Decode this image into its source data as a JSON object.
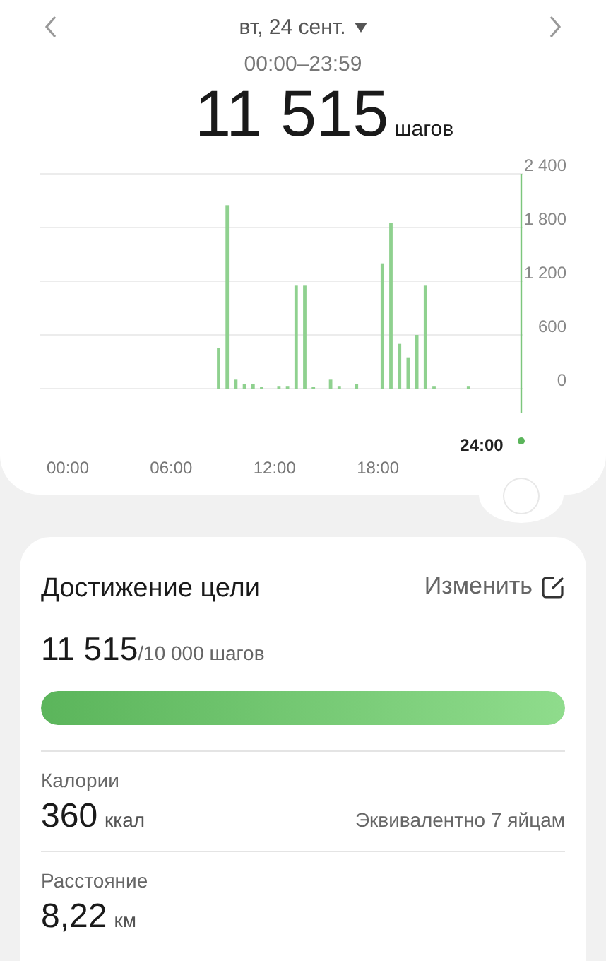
{
  "header": {
    "date": "вт, 24 сент.",
    "time_range": "00:00–23:59",
    "steps": "11 515",
    "steps_unit": "шагов"
  },
  "chart": {
    "cursor_label": "24:00",
    "chart_data": {
      "type": "bar",
      "x": [
        8.75,
        9.25,
        9.75,
        10.25,
        10.75,
        11.25,
        12.25,
        12.75,
        13.25,
        13.75,
        14.25,
        15.25,
        15.75,
        16.75,
        18.25,
        18.75,
        19.25,
        19.75,
        20.25,
        20.75,
        21.25,
        23.25
      ],
      "series": [
        {
          "color": "#8fd18f",
          "values": [
            450,
            2050,
            100,
            50,
            50,
            20,
            30,
            30,
            1150,
            1150,
            20,
            100,
            30,
            50,
            1400,
            1850,
            500,
            350,
            600,
            1150,
            30,
            30
          ]
        }
      ],
      "xticks": [
        {
          "value": 0,
          "label": "00:00"
        },
        {
          "value": 6,
          "label": "06:00"
        },
        {
          "value": 12,
          "label": "12:00"
        },
        {
          "value": 18,
          "label": "18:00"
        }
      ],
      "xlim": [
        -1.6,
        26.4
      ],
      "grid": true,
      "yticks": [
        {
          "value": 2400,
          "label": "2 400"
        },
        {
          "value": 1800,
          "label": "1 800"
        },
        {
          "value": 1200,
          "label": "1 200"
        },
        {
          "value": 600,
          "label": "600"
        },
        {
          "value": 0,
          "label": "0"
        }
      ],
      "ylim": [
        0,
        2400
      ]
    }
  },
  "goal": {
    "title": "Достижение цели",
    "edit_label": "Изменить",
    "steps": "11 515",
    "goal_text": "/10 000 шагов",
    "level": 1
  },
  "stats": [
    {
      "label": "Калории",
      "value": "360",
      "unit": "ккал",
      "note": "Эквивалентно 7 яйцам"
    },
    {
      "label": "Расстояние",
      "value": "8,22",
      "unit": "км"
    }
  ]
}
